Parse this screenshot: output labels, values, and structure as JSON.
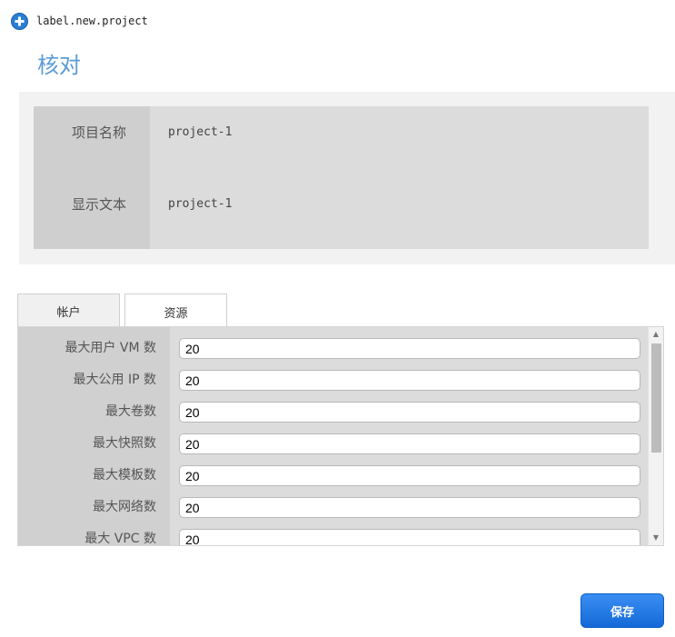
{
  "header": {
    "icon": "plus-circle-icon",
    "label": "label.new.project"
  },
  "title": "核对",
  "review": {
    "rows": [
      {
        "label": "项目名称",
        "value": "project-1"
      },
      {
        "label": "显示文本",
        "value": "project-1"
      }
    ]
  },
  "tabs": [
    {
      "label": "帐户",
      "active": false
    },
    {
      "label": "资源",
      "active": true
    }
  ],
  "resources": [
    {
      "label": "最大用户 VM 数",
      "value": "20"
    },
    {
      "label": "最大公用 IP 数",
      "value": "20"
    },
    {
      "label": "最大卷数",
      "value": "20"
    },
    {
      "label": "最大快照数",
      "value": "20"
    },
    {
      "label": "最大模板数",
      "value": "20"
    },
    {
      "label": "最大网络数",
      "value": "20"
    },
    {
      "label": "最大 VPC 数",
      "value": "20"
    }
  ],
  "save_label": "保存",
  "colors": {
    "title": "#5b9bd5",
    "button": "#1f78e6"
  }
}
